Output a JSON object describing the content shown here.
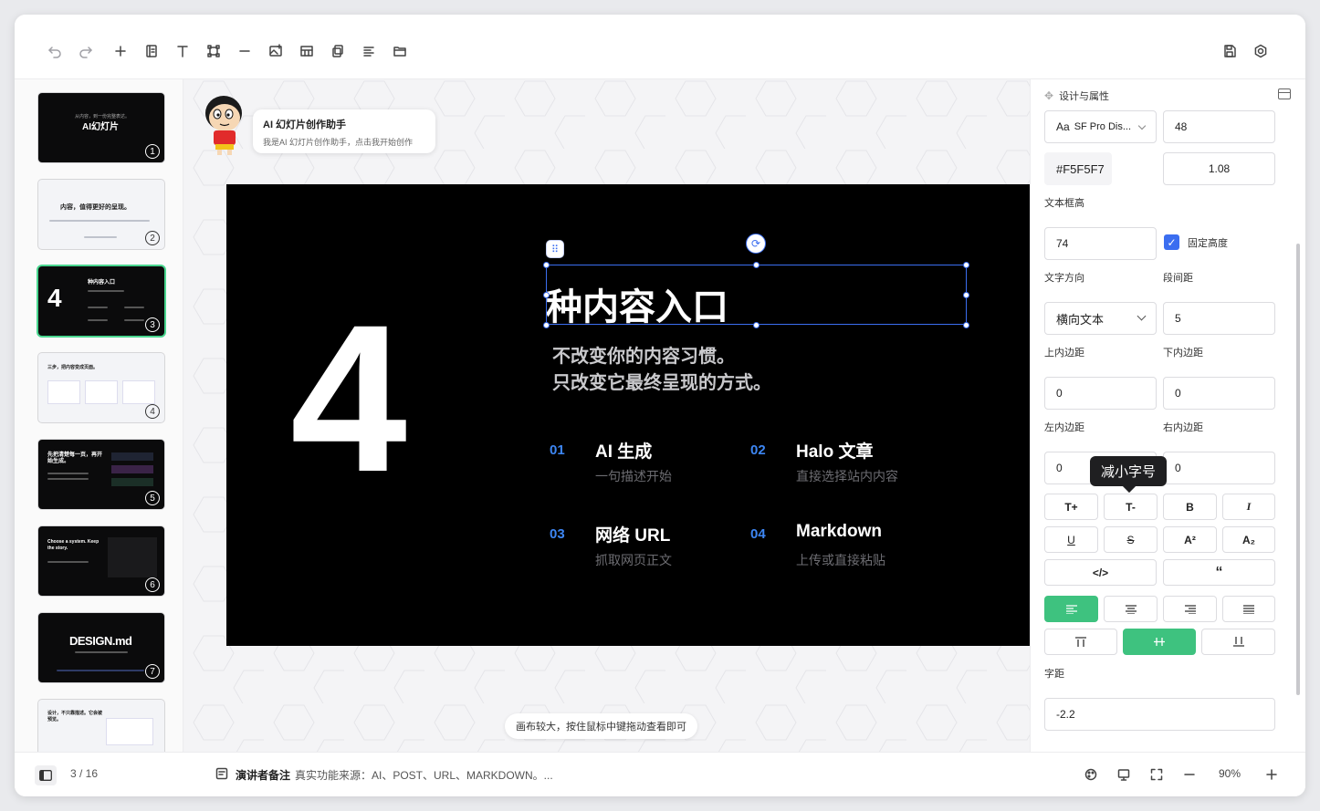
{
  "status": {
    "page_indicator": "3 / 16",
    "notes_label": "演讲者备注",
    "notes_text": "真实功能来源：AI、POST、URL、MARKDOWN。...",
    "zoom": "90%"
  },
  "thumbnails": [
    {
      "num": "1",
      "title": "AI幻灯片",
      "sub": "从内容，到一份完整表达。"
    },
    {
      "num": "2",
      "title": "内容，值得更好的呈现。"
    },
    {
      "num": "3",
      "big": "4",
      "title": "种内容入口"
    },
    {
      "num": "4",
      "title": "三步，把内容变成页面。"
    },
    {
      "num": "5",
      "title": "先把清楚每一页，再开始生成。"
    },
    {
      "num": "6",
      "title": "Choose a system. Keep the story."
    },
    {
      "num": "7",
      "title": "DESIGN.md"
    },
    {
      "num": "8",
      "title": "设计，不只靠描述。它会被预览。"
    }
  ],
  "assistant": {
    "title": "AI 幻灯片创作助手",
    "subtitle": "我是AI 幻灯片创作助手，点击我开始创作"
  },
  "slide": {
    "big_number": "4",
    "title": "种内容入口",
    "sub_line1": "不改变你的内容习惯。",
    "sub_line2": "只改变它最终呈现的方式。",
    "features": [
      {
        "num": "01",
        "title": "AI 生成",
        "desc": "一句描述开始"
      },
      {
        "num": "02",
        "title": "Halo 文章",
        "desc": "直接选择站内内容"
      },
      {
        "num": "03",
        "title": "网络 URL",
        "desc": "抓取网页正文"
      },
      {
        "num": "04",
        "title": "Markdown",
        "desc": "上传或直接粘贴"
      }
    ]
  },
  "canvas_hint": "画布较大，按住鼠标中键拖动查看即可",
  "panel": {
    "header": "设计与属性",
    "font_family": "SF Pro Dis...",
    "font_size": "48",
    "color": "#F5F5F7",
    "line_height": "1.08",
    "label_box_height": "文本框高",
    "box_height": "74",
    "fixed_height_label": "固定高度",
    "label_direction": "文字方向",
    "label_paragraph": "段间距",
    "direction": "横向文本",
    "paragraph_spacing": "5",
    "label_pad_top": "上内边距",
    "label_pad_bottom": "下内边距",
    "pad_top": "0",
    "pad_bottom": "0",
    "label_pad_left": "左内边距",
    "label_pad_right": "右内边距",
    "pad_left": "0",
    "pad_right": "0",
    "tooltip": "减小字号",
    "fmt_buttons": [
      "T+",
      "T-",
      "B",
      "I",
      "U",
      "S",
      "A²",
      "A₂"
    ],
    "code_btn": "</>",
    "quote_btn": "“",
    "label_letter_spacing": "字距",
    "letter_spacing": "-2.2"
  },
  "colors": {
    "accent_green": "#3ec27f",
    "selection_blue": "#3b6ef0",
    "feature_num_blue": "#3d86f3"
  }
}
